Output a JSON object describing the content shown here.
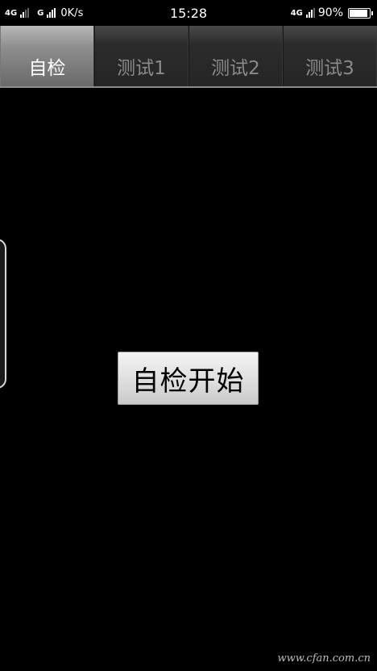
{
  "status_bar": {
    "network1": "4G",
    "network2": "G",
    "speed": "0K/s",
    "time": "15:28",
    "network3": "4G",
    "battery_percent": "90%",
    "battery_level": 0.9
  },
  "tabs": [
    {
      "label": "自检",
      "active": true
    },
    {
      "label": "测试1",
      "active": false
    },
    {
      "label": "测试2",
      "active": false
    },
    {
      "label": "测试3",
      "active": false
    }
  ],
  "main": {
    "start_button_label": "自检开始"
  },
  "watermark": "www.cfan.com.cn"
}
